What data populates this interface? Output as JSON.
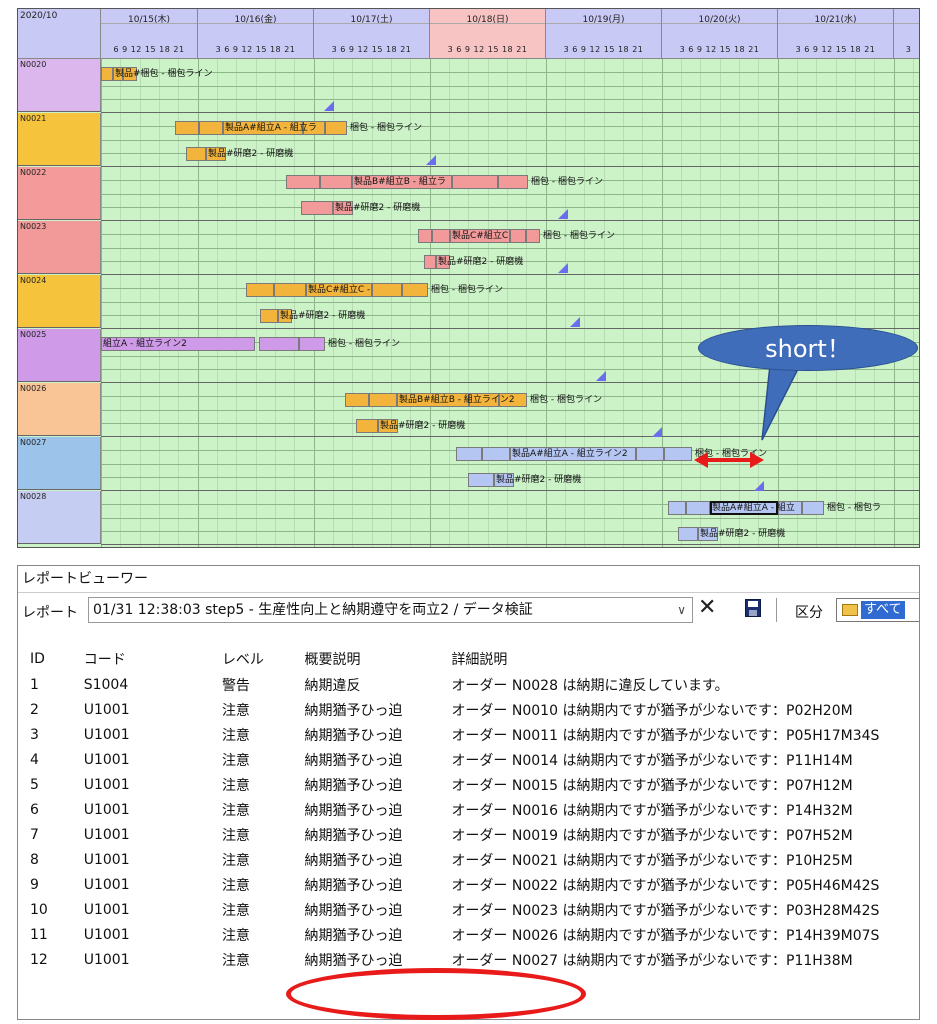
{
  "gantt": {
    "corner": "2020/10",
    "hours_label": "3  6  9 12 15 18 21",
    "days": [
      {
        "label": "10/15(木)",
        "hours": "6  9 12 15 18 21",
        "sunday": false
      },
      {
        "label": "10/16(金)",
        "hours": "3  6  9 12 15 18 21",
        "sunday": false
      },
      {
        "label": "10/17(土)",
        "hours": "3  6  9 12 15 18 21",
        "sunday": false
      },
      {
        "label": "10/18(日)",
        "hours": "3  6  9 12 15 18 21",
        "sunday": true
      },
      {
        "label": "10/19(月)",
        "hours": "3  6  9 12 15 18 21",
        "sunday": false
      },
      {
        "label": "10/20(火)",
        "hours": "3  6  9 12 15 18 21",
        "sunday": false
      },
      {
        "label": "10/21(水)",
        "hours": "3  6  9 12 15 18 21",
        "sunday": false
      },
      {
        "label": "",
        "hours": "3",
        "sunday": false
      }
    ],
    "orders": [
      "N0020",
      "N0021",
      "N0022",
      "N0023",
      "N0024",
      "N0025",
      "N0026",
      "N0027",
      "N0028"
    ],
    "bars": [
      {
        "text": "製品#梱包 - 梱包ライン",
        "prefix": "製"
      },
      {
        "text": "製品A#組立A - 組立ラ",
        "tail": "梱包 - 梱包ライン"
      },
      {
        "text": "製品#研磨2 - 研磨機"
      },
      {
        "text": "製品B#組立B - 組立ラ",
        "tail": "梱包 - 梱包ライン"
      },
      {
        "text": "製品#研磨2 - 研磨機"
      },
      {
        "text": "製品C#組立C",
        "tail": "梱包 - 梱包ライン"
      },
      {
        "text": "製品#研磨2 - 研磨機"
      },
      {
        "text": "製品C#組立C -",
        "tail": "梱包 - 梱包ライン"
      },
      {
        "text": "製品#研磨2 - 研磨機"
      },
      {
        "text": "組立A - 組立ライン2",
        "tail": "梱包 - 梱包ライン"
      },
      {
        "text": "製品B#組立B - 組立ライン2",
        "tail": "梱包 - 梱包ライン"
      },
      {
        "text": "製品#研磨2 - 研磨機"
      },
      {
        "text": "製品A#組立A - 組立ライン2",
        "tail": "梱包 - 梱包ライン"
      },
      {
        "text": "製品#研磨2 - 研磨機"
      },
      {
        "text": "製品A#組立A - 組立",
        "tail": "梱包 - 梱包ラ"
      },
      {
        "text": "製品#研磨2 - 研磨機"
      }
    ],
    "callout": "short！"
  },
  "report": {
    "title": "レポートビューワー",
    "report_label": "レポート",
    "report_value": "01/31 12:38:03 step5 - 生産性向上と納期遵守を両立2 / データ検証",
    "kubun_label": "区分",
    "kubun_value": "すべて",
    "columns": {
      "id": "ID",
      "code": "コード",
      "level": "レベル",
      "summary": "概要説明",
      "detail": "詳細説明"
    },
    "rows": [
      {
        "id": "1",
        "code": "S1004",
        "level": "警告",
        "summary": "納期違反",
        "detail": "オーダー N0028 は納期に違反しています。"
      },
      {
        "id": "2",
        "code": "U1001",
        "level": "注意",
        "summary": "納期猶予ひっ迫",
        "detail": "オーダー N0010 は納期内ですが猶予が少ないです：P02H20M"
      },
      {
        "id": "3",
        "code": "U1001",
        "level": "注意",
        "summary": "納期猶予ひっ迫",
        "detail": "オーダー N0011 は納期内ですが猶予が少ないです：P05H17M34S"
      },
      {
        "id": "4",
        "code": "U1001",
        "level": "注意",
        "summary": "納期猶予ひっ迫",
        "detail": "オーダー N0014 は納期内ですが猶予が少ないです：P11H14M"
      },
      {
        "id": "5",
        "code": "U1001",
        "level": "注意",
        "summary": "納期猶予ひっ迫",
        "detail": "オーダー N0015 は納期内ですが猶予が少ないです：P07H12M"
      },
      {
        "id": "6",
        "code": "U1001",
        "level": "注意",
        "summary": "納期猶予ひっ迫",
        "detail": "オーダー N0016 は納期内ですが猶予が少ないです：P14H32M"
      },
      {
        "id": "7",
        "code": "U1001",
        "level": "注意",
        "summary": "納期猶予ひっ迫",
        "detail": "オーダー N0019 は納期内ですが猶予が少ないです：P07H52M"
      },
      {
        "id": "8",
        "code": "U1001",
        "level": "注意",
        "summary": "納期猶予ひっ迫",
        "detail": "オーダー N0021 は納期内ですが猶予が少ないです：P10H25M"
      },
      {
        "id": "9",
        "code": "U1001",
        "level": "注意",
        "summary": "納期猶予ひっ迫",
        "detail": "オーダー N0022 は納期内ですが猶予が少ないです：P05H46M42S"
      },
      {
        "id": "10",
        "code": "U1001",
        "level": "注意",
        "summary": "納期猶予ひっ迫",
        "detail": "オーダー N0023 は納期内ですが猶予が少ないです：P03H28M42S"
      },
      {
        "id": "11",
        "code": "U1001",
        "level": "注意",
        "summary": "納期猶予ひっ迫",
        "detail": "オーダー N0026 は納期内ですが猶予が少ないです：P14H39M07S"
      },
      {
        "id": "12",
        "code": "U1001",
        "level": "注意",
        "summary": "納期猶予ひっ迫",
        "detail": "オーダー N0027 は納期内ですが猶予が少ないです：P11H38M"
      }
    ]
  }
}
